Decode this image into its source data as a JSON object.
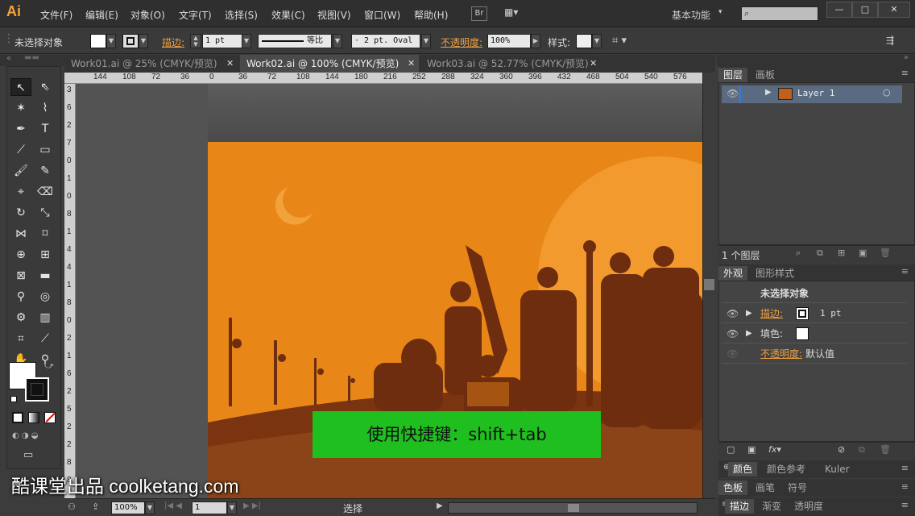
{
  "app": {
    "logo": "Ai",
    "badge_br": "Br",
    "workspace": "基本功能"
  },
  "menu": [
    "文件(F)",
    "编辑(E)",
    "对象(O)",
    "文字(T)",
    "选择(S)",
    "效果(C)",
    "视图(V)",
    "窗口(W)",
    "帮助(H)"
  ],
  "window_buttons": {
    "minimize": "—",
    "maximize": "□",
    "close": "✕"
  },
  "control": {
    "selection": "未选择对象",
    "stroke_label": "描边:",
    "stroke_weight": "1 pt",
    "profile_label": "等比",
    "brush_label": "2 pt. Oval",
    "opacity_label": "不透明度:",
    "opacity_value": "100%",
    "style_label": "样式:"
  },
  "tabs": [
    {
      "label": "Work01.ai @ 25% (CMYK/预览)",
      "active": false
    },
    {
      "label": "Work02.ai @ 100% (CMYK/预览)",
      "active": true
    },
    {
      "label": "Work03.ai @ 52.77% (CMYK/预览)",
      "active": false
    }
  ],
  "hruler_ticks": [
    "144",
    "108",
    "72",
    "36",
    "0",
    "36",
    "72",
    "108",
    "144",
    "180",
    "216",
    "252",
    "288",
    "324",
    "360",
    "396",
    "432",
    "468",
    "504",
    "540",
    "576"
  ],
  "vruler_ticks": [
    "3",
    "6",
    "2",
    "7",
    "0",
    "1",
    "0",
    "8",
    "1",
    "4",
    "4",
    "1",
    "8",
    "0",
    "2",
    "1",
    "6",
    "2",
    "5",
    "2",
    "2",
    "8",
    "8"
  ],
  "status": {
    "zoom": "100%",
    "page": "1",
    "tool": "选择"
  },
  "caption": "使用快捷键：shift+tab",
  "watermark": "酷课堂出品 coolketang.com",
  "layers_panel": {
    "tabs": [
      "图层",
      "画板"
    ],
    "layer_name": "Layer 1",
    "count": "1 个图层"
  },
  "appearance_panel": {
    "tabs": [
      "外观",
      "图形样式"
    ],
    "title": "未选择对象",
    "stroke_label": "描边:",
    "stroke_value": "1 pt",
    "fill_label": "填色:",
    "opacity_label": "不透明度:",
    "opacity_value": "默认值"
  },
  "color_panels": {
    "row1": [
      "颜色",
      "颜色参考",
      "Kuler"
    ],
    "row2": [
      "色板",
      "画笔",
      "符号"
    ],
    "row3": [
      "描边",
      "渐变",
      "透明度"
    ]
  },
  "colors": {
    "accent": "#f0a040",
    "artboard": "#e88617",
    "silhouette": "#6e2d0e",
    "caption_bg": "#1fbf1f"
  }
}
